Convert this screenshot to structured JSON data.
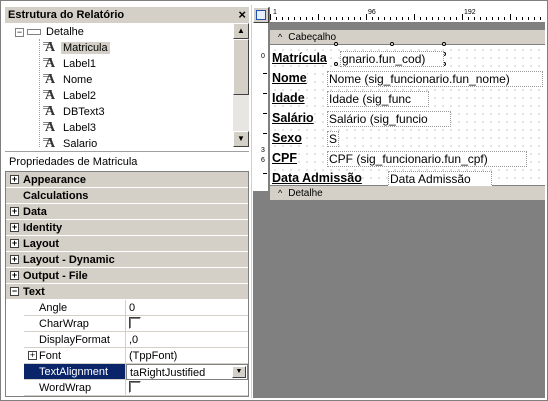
{
  "structure": {
    "title": "Estrutura do Relatório",
    "close_icon": "close-icon",
    "root": "Detalhe",
    "items": [
      {
        "label": "Matricula",
        "selected": true
      },
      {
        "label": "Label1"
      },
      {
        "label": "Nome"
      },
      {
        "label": "Label2"
      },
      {
        "label": "DBText3"
      },
      {
        "label": "Label3"
      },
      {
        "label": "Salario"
      }
    ]
  },
  "properties": {
    "caption": "Propriedades de Matricula",
    "categories": [
      {
        "label": "Appearance",
        "expander": "+"
      },
      {
        "label": "Calculations",
        "expander": ""
      },
      {
        "label": "Data",
        "expander": "+"
      },
      {
        "label": "Identity",
        "expander": "+"
      },
      {
        "label": "Layout",
        "expander": "+"
      },
      {
        "label": "Layout - Dynamic",
        "expander": "+"
      },
      {
        "label": "Output - File",
        "expander": "+"
      },
      {
        "label": "Text",
        "expander": "−"
      }
    ],
    "text_props": [
      {
        "name": "Angle",
        "value": "0"
      },
      {
        "name": "CharWrap",
        "value": ""
      },
      {
        "name": "DisplayFormat",
        "value": ",0"
      },
      {
        "name": "Font",
        "value": "(TppFont)"
      },
      {
        "name": "TextAlignment",
        "value": "taRightJustified"
      },
      {
        "name": "WordWrap",
        "value": ""
      }
    ]
  },
  "designer": {
    "ruler": {
      "marks": [
        "1",
        "96",
        "192"
      ]
    },
    "vruler_marks": [
      "0",
      "3",
      "6"
    ],
    "header_band": "Cabeçalho",
    "detail_band": "Detalhe",
    "fields": [
      {
        "label": "Matrícula",
        "data": "gnario.fun_cod)"
      },
      {
        "label": "Nome",
        "data": "Nome (sig_funcionario.fun_nome)"
      },
      {
        "label": "Idade",
        "data": "Idade (sig_func"
      },
      {
        "label": "Salário",
        "data": "Salário (sig_funcio"
      },
      {
        "label": "Sexo",
        "data": "S"
      },
      {
        "label": "CPF",
        "data": "CPF (sig_funcionario.fun_cpf)"
      },
      {
        "label": "Data Admissão",
        "data": "Data Admissão"
      }
    ]
  }
}
